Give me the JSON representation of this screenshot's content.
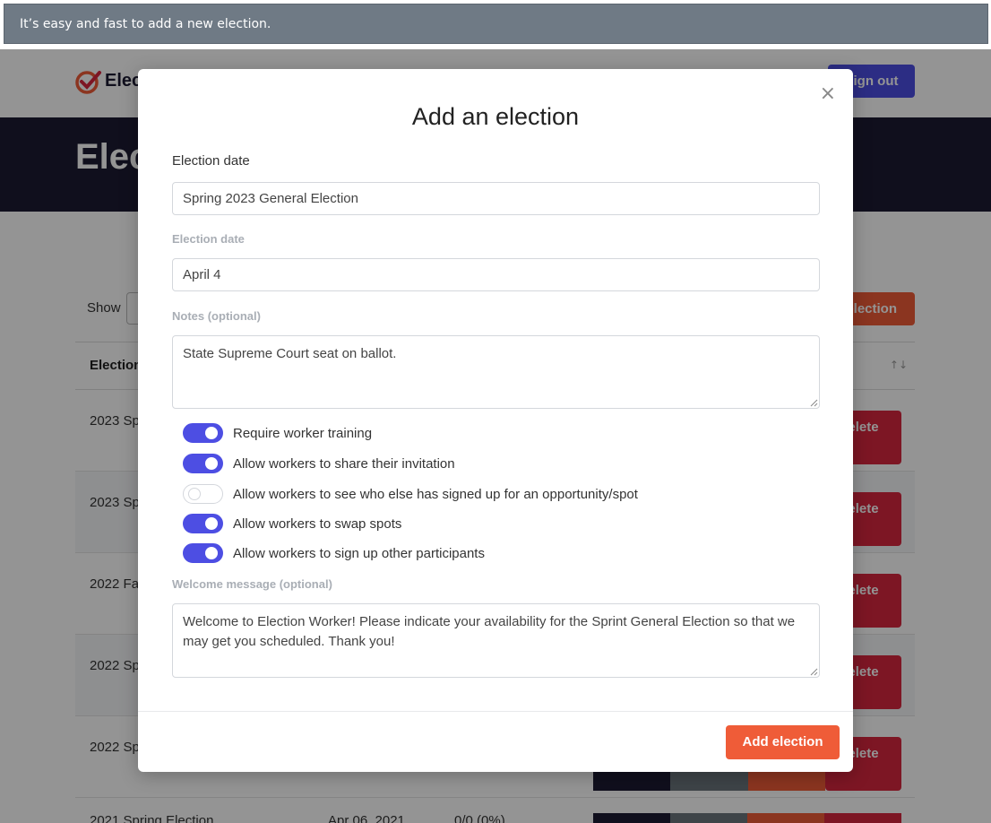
{
  "caption": "It’s easy and fast to add a new election.",
  "background": {
    "logo_text": "Elec",
    "sign_out": "Sign out",
    "hero_title": "Elec",
    "show_label": "Show",
    "add_button": "election",
    "table_header": "Election",
    "sort_glyph": "↑↓",
    "rows": [
      {
        "name": "2023 Sp",
        "delete": "elete"
      },
      {
        "name": "2023 Sp",
        "delete": "elete"
      },
      {
        "name": "2022 Fa",
        "delete": "elete"
      },
      {
        "name": "2022 Sp",
        "delete": "elete"
      },
      {
        "name": "2022 Sp",
        "delete": "elete"
      }
    ],
    "last_row": {
      "name": "2021 Spring Election",
      "date": "Apr 06, 2021",
      "ratio": "0/0 (0%)"
    }
  },
  "modal": {
    "title": "Add an election",
    "close_glyph": "×",
    "name_label": "Election date",
    "name_value": "Spring 2023 General Election",
    "date_label": "Election date",
    "date_value": "April 4",
    "notes_label": "Notes (optional)",
    "notes_value": "State Supreme Court seat on ballot.",
    "toggles": [
      {
        "label": "Require worker training",
        "on": true
      },
      {
        "label": "Allow workers to share their invitation",
        "on": true
      },
      {
        "label": "Allow workers to see who else has signed up for an opportunity/spot",
        "on": false
      },
      {
        "label": "Allow workers to swap spots",
        "on": true
      },
      {
        "label": "Allow workers to sign up other participants",
        "on": true
      }
    ],
    "welcome_label": "Welcome message (optional)",
    "welcome_value": "Welcome to Election Worker! Please indicate your availability for the Sprint General Election so that we may get you scheduled. Thank you!",
    "submit_label": "Add election"
  },
  "colors": {
    "accent": "#4d4ee3",
    "orange": "#ef5c38",
    "danger": "#d8263f",
    "navy": "#1c1b33",
    "caption_bg": "#6f7a85"
  }
}
